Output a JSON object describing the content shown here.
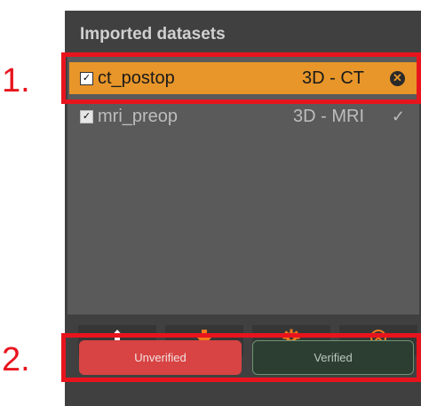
{
  "panel": {
    "title": "Imported datasets"
  },
  "datasets": [
    {
      "name": "ct_postop",
      "modality": "3D - CT",
      "checked": true,
      "selected": true,
      "status_icon": "close-circle-icon"
    },
    {
      "name": "mri_preop",
      "modality": "3D - MRI",
      "checked": true,
      "selected": false,
      "status": "✓",
      "status_icon": "checkmark-icon"
    }
  ],
  "toolbar": {
    "buttons": [
      {
        "icon": "arrow-up-icon",
        "glyph": "🡅",
        "color": "#ffffff"
      },
      {
        "icon": "arrow-down-icon",
        "glyph": "🡇",
        "color": "#f07b1c"
      },
      {
        "icon": "gear-icon",
        "glyph": "⚙",
        "color": "#f07b1c"
      },
      {
        "icon": "cancel-circle-icon",
        "glyph": "⊗",
        "color": "#f07b1c"
      }
    ]
  },
  "verification": {
    "unverified_label": "Unverified",
    "verified_label": "Verified"
  },
  "annotations": {
    "label_1": "1.",
    "label_2": "2."
  },
  "colors": {
    "selected_row": "#e8962a",
    "annotation": "#e8141d",
    "unverified": "#d84343",
    "verified": "#2c3e32"
  }
}
